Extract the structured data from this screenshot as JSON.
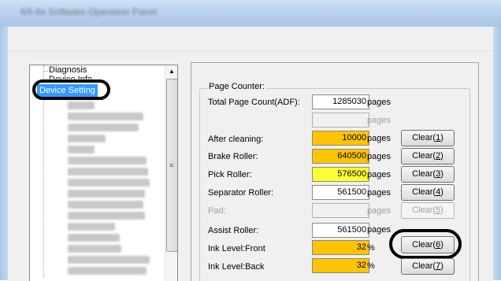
{
  "window": {
    "title": "fi/fi-6x Software Operation Panel"
  },
  "tree": {
    "items": [
      {
        "label": "Diagnosis"
      },
      {
        "label": "Device Info"
      },
      {
        "label": "Device Setting",
        "selected": true
      }
    ]
  },
  "counter": {
    "group_label": "Page Counter:",
    "total": {
      "label": "Total Page Count(ADF):",
      "value": "1285030",
      "unit": "pages"
    },
    "blank_unit": "pages",
    "rows": [
      {
        "label": "After cleaning:",
        "value": "10000",
        "unit": "pages",
        "button": "Clear(1)",
        "button_text": "Clear(",
        "button_key": "1",
        "button_end": ")",
        "color": "orange"
      },
      {
        "label": "Brake Roller:",
        "value": "640500",
        "unit": "pages",
        "button_text": "Clear(",
        "button_key": "2",
        "button_end": ")",
        "color": "orange"
      },
      {
        "label": "Pick Roller:",
        "value": "576500",
        "unit": "pages",
        "button_text": "Clear(",
        "button_key": "3",
        "button_end": ")",
        "color": "yellow"
      },
      {
        "label": "Separator Roller:",
        "value": "561500",
        "unit": "pages",
        "button_text": "Clear(",
        "button_key": "4",
        "button_end": ")",
        "color": "white"
      },
      {
        "label": "Pad:",
        "value": "",
        "unit": "pages",
        "button_text": "Clear(",
        "button_key": "5",
        "button_end": ")",
        "color": "grey",
        "disabled": true
      },
      {
        "label": "Assist Roller:",
        "value": "561500",
        "unit": "pages",
        "color": "white"
      },
      {
        "label": "Ink Level:Front",
        "value": "32",
        "unit": "%",
        "button_text": "Clear(",
        "button_key": "6",
        "button_end": ")",
        "color": "orange"
      },
      {
        "label": "Ink Level:Back",
        "value": "32",
        "unit": "%",
        "button_text": "Clear(",
        "button_key": "7",
        "button_end": ")",
        "color": "orange"
      }
    ]
  },
  "colors": {
    "orange": "#ffc400",
    "yellow": "#ffff33",
    "selection": "#3399ff",
    "titlebar": "#b9d1ec"
  }
}
